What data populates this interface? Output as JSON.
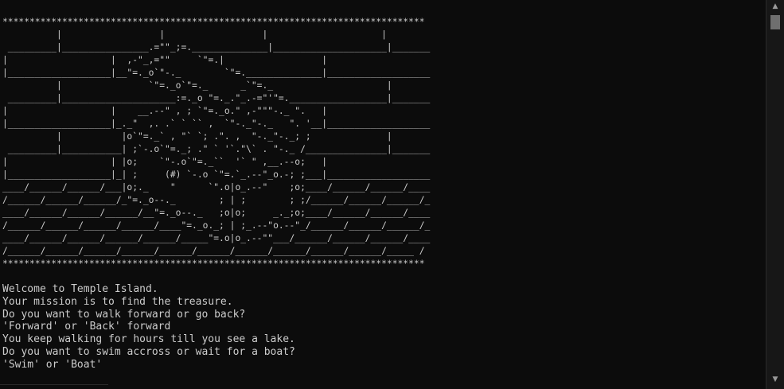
{
  "console": {
    "ascii_art": "******************************************************************************\n          |                  |                  |                     |\n _________|________________.=\"\"_;=.______________|_____________________|_______\n|                   |  ,-\"_,=\"\"     `\"=.|                  |\n|___________________|__\"=._o`\"-._        `\"=.______________|___________________\n          |                `\"=._o`\"=._      _`\"=._                     |\n _________|_____________________:=._o \"=._.\"_.-=\"'\"=.__________________|_______\n|                   |    __.--\" , ; `\"=._o.\" ,-\"\"\"-._ \".   |\n|___________________|_._\"  ,. .` ` `` ,  `\"-._\"-._   \". '__|___________________\n          |           |o`\"=._` , \"` `; .\". ,  \"-._\"-._; ;              |\n _________|___________| ;`-.o`\"=._; .\" ` '`.\"\\` . \"-._ /_______________|_______\n|                   | |o;    `\"-.o`\"=._``  '` \" ,__.--o;   |\n|___________________|_| ;     (#) `-.o `\"=.`_.--\"_o.-; ;___|___________________\n____/______/______/___|o;._    \"      `\".o|o_.--\"    ;o;____/______/______/____\n/______/______/______/_\"=._o--._        ; | ;        ; ;/______/______/______/_\n____/______/______/______/__\"=._o--._   ;o|o;     _._;o;____/______/______/____\n/______/______/______/______/____\"=._o._; | ;_.--\"o.--\"_/______/______/______/_\n____/______/______/______/______/_____\"=.o|o_.--\"\"___/______/______/______/____\n/______/______/______/______/______/______/______/______/______/______/_____ /\n******************************************************************************",
    "lines": [
      "Welcome to Temple Island.",
      "Your mission is to find the treasure.",
      "Do you want to walk forward or go back?",
      "'Forward' or 'Back' forward",
      "You keep walking for hours till you see a lake.",
      "Do you want to swim accross or wait for a boat?",
      "'Swim' or 'Boat'"
    ]
  },
  "scrollbar": {
    "up_icon": "▲",
    "down_icon": "▼"
  }
}
